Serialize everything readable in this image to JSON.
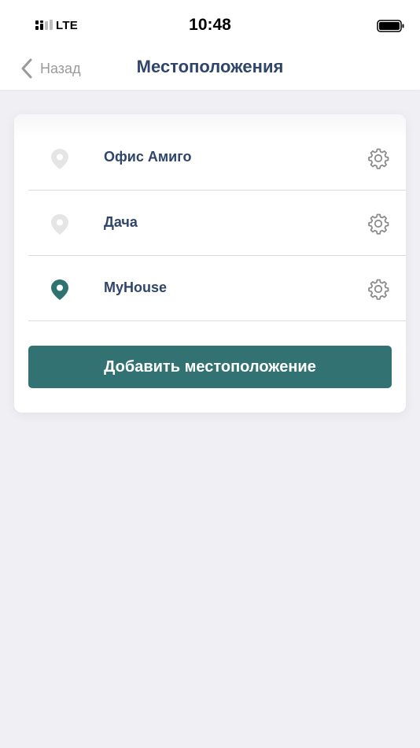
{
  "status_bar": {
    "carrier": "LTE",
    "time": "10:48"
  },
  "nav": {
    "back_label": "Назад",
    "title": "Местоположения"
  },
  "locations": [
    {
      "name": "Офис Амиго",
      "active": false
    },
    {
      "name": "Дача",
      "active": false
    },
    {
      "name": "MyHouse",
      "active": true
    }
  ],
  "add_button_label": "Добавить местоположение",
  "colors": {
    "accent": "#337272",
    "title": "#2f4569",
    "pin_inactive": "#e5e5e5",
    "pin_active": "#2f7272",
    "background": "#efeff4"
  },
  "icons": {
    "pin": "map-pin-icon",
    "gear": "gear-icon",
    "back": "chevron-left-icon"
  }
}
